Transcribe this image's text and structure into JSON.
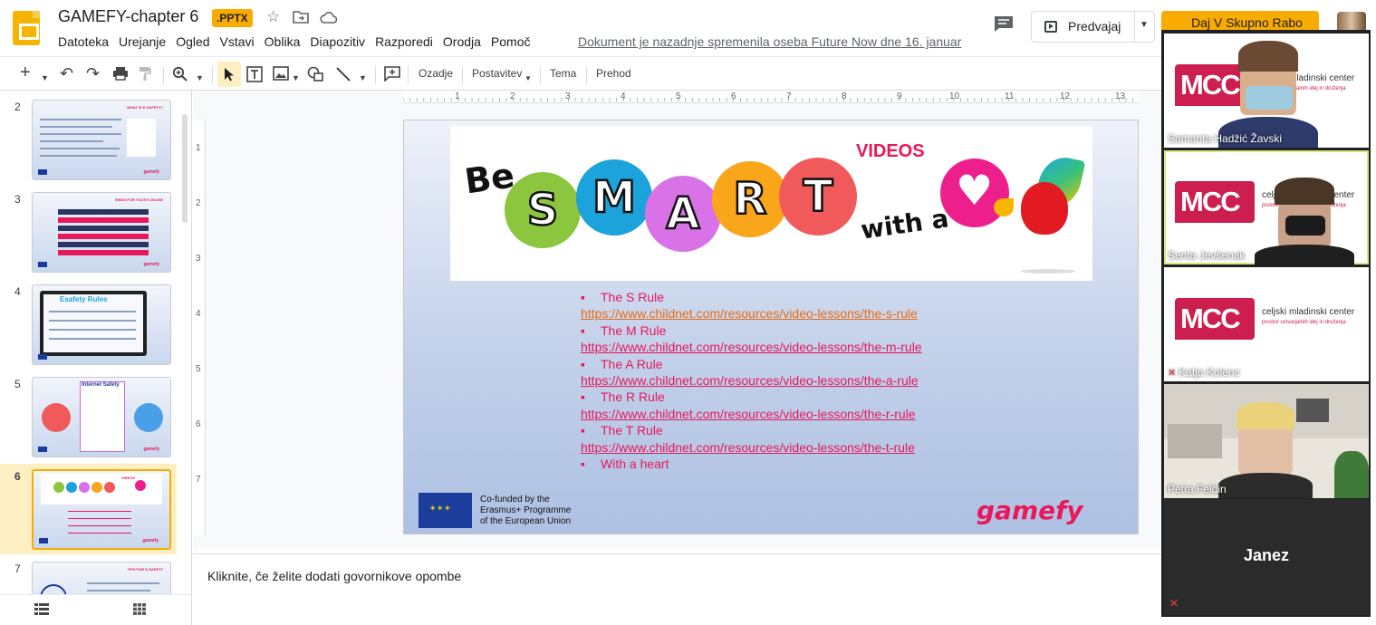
{
  "header": {
    "title": "GAMEFY-chapter 6",
    "badge": ".PPTX",
    "menu": [
      "Datoteka",
      "Urejanje",
      "Ogled",
      "Vstavi",
      "Oblika",
      "Diapozitiv",
      "Razporedi",
      "Orodja",
      "Pomoč"
    ],
    "last_edit": "Dokument je nazadnje spremenila oseba Future Now dne 16. januar",
    "present_label": "Predvajaj",
    "share_label": "Daj V Skupno Rabo"
  },
  "toolbar": {
    "background_label": "Ozadje",
    "layout_label": "Postavitev",
    "theme_label": "Tema",
    "transition_label": "Prehod"
  },
  "ruler": {
    "h": [
      "1",
      "2",
      "3",
      "4",
      "5",
      "6",
      "7",
      "8",
      "9",
      "10",
      "11",
      "12",
      "13"
    ],
    "v": [
      "1",
      "2",
      "3",
      "4",
      "5",
      "6",
      "7"
    ]
  },
  "filmstrip": {
    "numbers": [
      "2",
      "3",
      "4",
      "5",
      "6",
      "7"
    ],
    "slide2_title": "WHAT IS E-SAFETY?",
    "slide3_title": "RISKS FOR YOUTH ONLINE",
    "slide4_title": "Esafety Rules",
    "slide5_title": "Internet Safety",
    "slide6_title": "VIDEOS",
    "slide7_title": "TIPS FOR E-SAFETY",
    "gamefy_mark": "gamefy"
  },
  "slide": {
    "banner_be": "Be",
    "banner_letters": [
      "S",
      "M",
      "A",
      "R",
      "T"
    ],
    "banner_with": "with a",
    "videos": "VIDEOS",
    "rules": [
      {
        "title": "The S Rule",
        "link": "https://www.childnet.com/resources/video-lessons/the-s-rule"
      },
      {
        "title": "The M Rule",
        "link": "https://www.childnet.com/resources/video-lessons/the-m-rule"
      },
      {
        "title": "The A Rule",
        "link": "https://www.childnet.com/resources/video-lessons/the-a-rule"
      },
      {
        "title": "The R Rule",
        "link": "https://www.childnet.com/resources/video-lessons/the-r-rule"
      },
      {
        "title": "The T Rule",
        "link": "https://www.childnet.com/resources/video-lessons/the-t-rule"
      },
      {
        "title": "With a heart",
        "link": ""
      }
    ],
    "eu_text": "Co-funded by the\nErasmus+ Programme\nof the European Union",
    "gamefy": "gamefy"
  },
  "notes_placeholder": "Kliknite, če želite dodati govornikove opombe",
  "participants": [
    {
      "name": "Samanta Hadžić Žavski",
      "caption": "celjski mladinski center",
      "sub": "prostor ustvarjalnih idej in druženja",
      "muted": false
    },
    {
      "name": "Senta Jevšenak",
      "caption": "celjski mladinski center",
      "sub": "prostor ustvarjalnih idej in druženja",
      "muted": false
    },
    {
      "name": "Katja Kolenc",
      "caption": "celjski mladinski center",
      "sub": "prostor ustvarjalnih idej in druženja",
      "muted": true
    },
    {
      "name": "Petra Feldin",
      "muted": false
    },
    {
      "name": "Janez",
      "muted": true
    }
  ],
  "mcc_logo": "MCC",
  "colors": {
    "accent": "#f9ab00",
    "brand_pink": "#e8185a",
    "circle_s": "#8cc63f",
    "circle_m": "#1ca3dc",
    "circle_a": "#d872e6",
    "circle_r": "#f9a61a",
    "circle_t": "#f05a5a"
  }
}
